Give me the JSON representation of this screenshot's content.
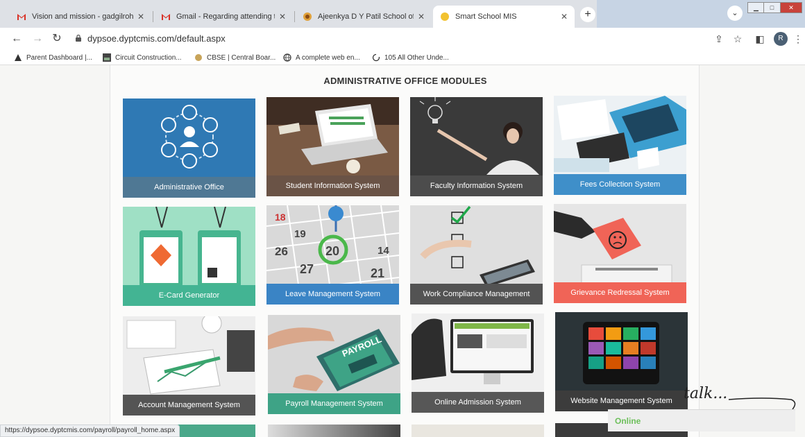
{
  "browser": {
    "tabs": [
      {
        "title": "Vision and mission - gadgilrohini",
        "favicon": "gmail-icon",
        "active": false
      },
      {
        "title": "Gmail - Regarding attending the",
        "favicon": "gmail-icon",
        "active": false
      },
      {
        "title": "Ajeenkya D Y Patil School of Eng",
        "favicon": "school-icon",
        "active": false
      },
      {
        "title": "Smart School MIS",
        "favicon": "loading-icon",
        "active": true
      }
    ],
    "url": "dypsoe.dyptcmis.com/default.aspx",
    "profile_initial": "R",
    "bookmarks": [
      {
        "label": "Parent Dashboard |...",
        "icon": "triangle-icon"
      },
      {
        "label": "Circuit Construction...",
        "icon": "image-icon"
      },
      {
        "label": "CBSE | Central Boar...",
        "icon": "emblem-icon"
      },
      {
        "label": "A complete web en...",
        "icon": "globe-icon"
      },
      {
        "label": "105 All Other Unde...",
        "icon": "refresh-icon"
      }
    ]
  },
  "page": {
    "heading": "ADMINISTRATIVE OFFICE MODULES",
    "modules": [
      {
        "label": "Administrative Office",
        "caption_color": "#4f7894"
      },
      {
        "label": "Student Information System",
        "caption_color": "#6a5346"
      },
      {
        "label": "Faculty Information System",
        "caption_color": "#4c4c4c"
      },
      {
        "label": "Fees Collection System",
        "caption_color": "#3f8fc9"
      },
      {
        "label": "E-Card Generator",
        "caption_color": "#43b493"
      },
      {
        "label": "Leave Management System",
        "caption_color": "#3a84c5"
      },
      {
        "label": "Work Compliance Management",
        "caption_color": "#535353"
      },
      {
        "label": "Grievance Redressal System",
        "caption_color": "#f06457"
      },
      {
        "label": "Account Management System",
        "caption_color": "#545454"
      },
      {
        "label": "Payroll Management System",
        "caption_color": "#3ea386"
      },
      {
        "label": "Online Admission System",
        "caption_color": "#575757"
      },
      {
        "label": "Website Management System",
        "caption_color": "#3c3c3c"
      }
    ]
  },
  "status_url": "https://dypsoe.dyptcmis.com/payroll/payroll_home.aspx",
  "chat": {
    "status": "Online",
    "tagline": "talk..."
  }
}
